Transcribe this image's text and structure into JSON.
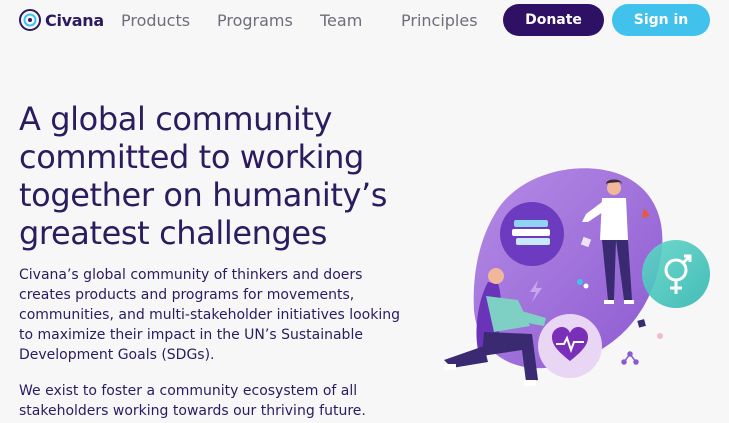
{
  "nav": {
    "brand": "Civana",
    "links": [
      "Products",
      "Programs",
      "Team",
      "Principles"
    ],
    "donate_label": "Donate",
    "signin_label": "Sign in"
  },
  "hero": {
    "headline": "A global community committed to working together on humanity’s greatest challenges",
    "paragraph1": "Civana’s global community of thinkers and doers creates products and programs for movements, communities, and multi-stakeholder initiatives looking to maximize their impact in the UN’s Sustainable Development Goals (SDGs).",
    "paragraph2": "We exist to foster a community ecosystem of all stakeholders working towards our thriving future."
  },
  "colors": {
    "brand_dark": "#2e1065",
    "accent_cyan": "#41c2ec",
    "text": "#2b1b5f",
    "nav_text": "#6e6e7a",
    "blob": "#a070d8"
  },
  "illustration_icons": [
    "books-icon",
    "heart-pulse-icon",
    "gender-equality-icon",
    "lightning-icon",
    "network-icon"
  ]
}
